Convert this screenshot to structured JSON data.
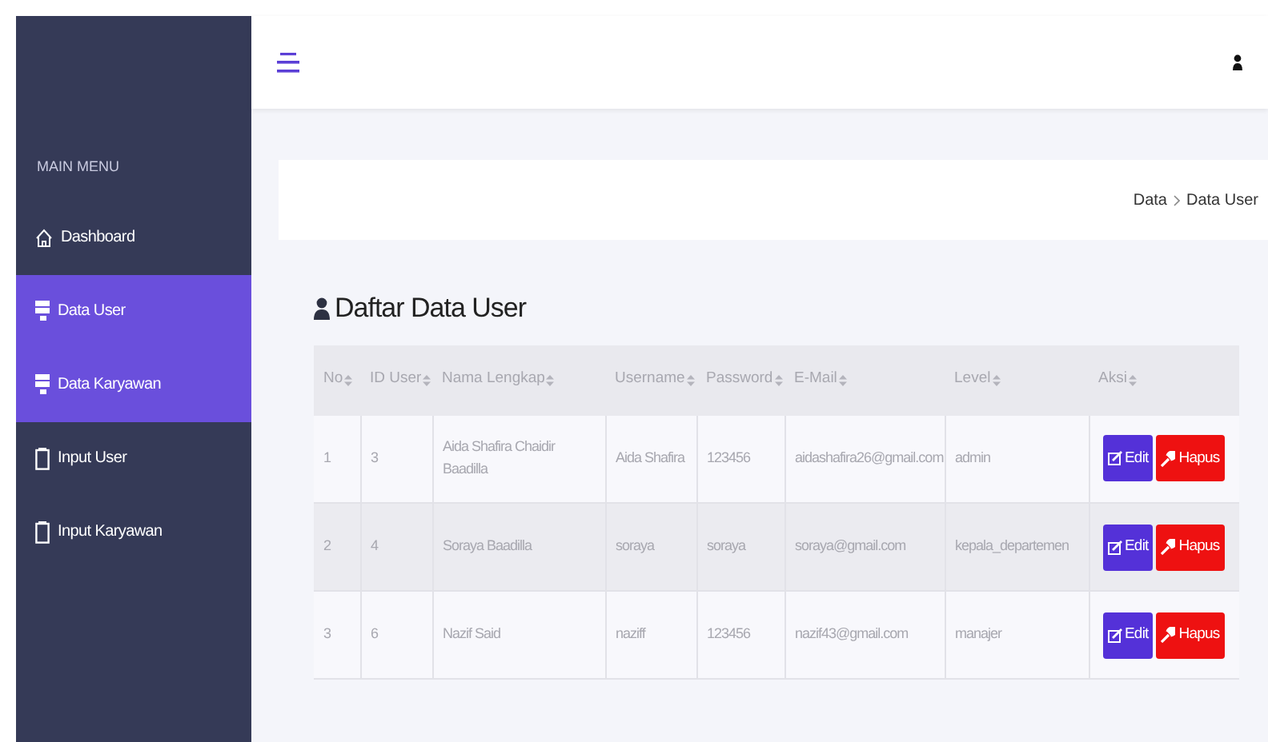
{
  "sidebar": {
    "heading": "MAIN MENU",
    "items": [
      {
        "label": "Dashboard",
        "kind": "home",
        "selected": false
      },
      {
        "label": "Data User",
        "kind": "data",
        "selected": true
      },
      {
        "label": "Data Karyawan",
        "kind": "data",
        "selected": true
      },
      {
        "label": "Input User",
        "kind": "input",
        "selected": false
      },
      {
        "label": "Input Karyawan",
        "kind": "input",
        "selected": false
      }
    ]
  },
  "breadcrumb": [
    "Data",
    "Data User"
  ],
  "page_title": "Daftar Data User",
  "table": {
    "columns": [
      "No",
      "ID User",
      "Nama Lengkap",
      "Username",
      "Password",
      "E-Mail",
      "Level",
      "Aksi"
    ],
    "rows": [
      {
        "cells": [
          "1",
          "3",
          "Aida Shafira Chaidir Baadilla",
          "Aida Shafira",
          "123456",
          "aidashafira26@gmail.com",
          "admin"
        ],
        "actions": [
          "Edit",
          "Hapus"
        ]
      },
      {
        "cells": [
          "2",
          "4",
          "Soraya Baadilla",
          "soraya",
          "soraya",
          "soraya@gmail.com",
          "kepala_departemen"
        ],
        "actions": [
          "Edit",
          "Hapus"
        ]
      },
      {
        "cells": [
          "3",
          "6",
          "Nazif Said",
          "naziff",
          "123456",
          "nazif43@gmail.com",
          "manajer"
        ],
        "actions": [
          "Edit",
          "Hapus"
        ]
      }
    ]
  }
}
